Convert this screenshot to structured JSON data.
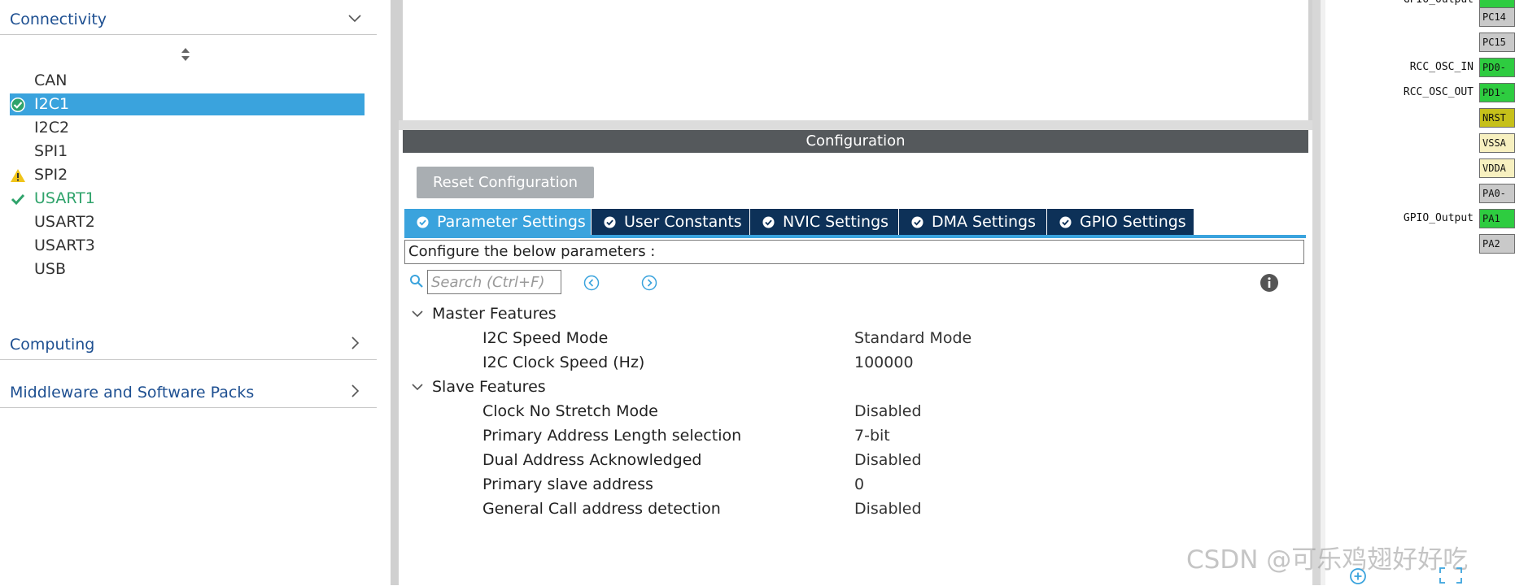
{
  "left_panel": {
    "categories": [
      {
        "label": "Connectivity",
        "expanded": true
      },
      {
        "label": "Computing",
        "expanded": false
      },
      {
        "label": "Middleware and Software Packs",
        "expanded": false
      }
    ],
    "peripherals": [
      {
        "label": "CAN",
        "status": "none"
      },
      {
        "label": "I2C1",
        "status": "ok",
        "selected": true
      },
      {
        "label": "I2C2",
        "status": "none"
      },
      {
        "label": "SPI1",
        "status": "none"
      },
      {
        "label": "SPI2",
        "status": "warning"
      },
      {
        "label": "USART1",
        "status": "ok"
      },
      {
        "label": "USART2",
        "status": "none"
      },
      {
        "label": "USART3",
        "status": "none"
      },
      {
        "label": "USB",
        "status": "none"
      }
    ]
  },
  "config": {
    "title": "Configuration",
    "reset_label": "Reset Configuration",
    "tabs": [
      {
        "label": "Parameter Settings",
        "active": true
      },
      {
        "label": "User Constants"
      },
      {
        "label": "NVIC Settings"
      },
      {
        "label": "DMA Settings"
      },
      {
        "label": "GPIO Settings"
      }
    ],
    "configure_text": "Configure the below parameters :",
    "search_placeholder": "Search (Ctrl+F)",
    "groups": [
      {
        "label": "Master Features",
        "params": [
          {
            "name": "I2C Speed Mode",
            "value": "Standard Mode"
          },
          {
            "name": "I2C Clock Speed (Hz)",
            "value": "100000"
          }
        ]
      },
      {
        "label": "Slave Features",
        "params": [
          {
            "name": "Clock No Stretch Mode",
            "value": "Disabled"
          },
          {
            "name": "Primary Address Length selection",
            "value": "7-bit"
          },
          {
            "name": "Dual Address Acknowledged",
            "value": "Disabled"
          },
          {
            "name": "Primary slave address",
            "value": "0"
          },
          {
            "name": "General Call address detection",
            "value": "Disabled"
          }
        ]
      }
    ]
  },
  "pinout": {
    "top_label": "GPIO_Output",
    "pins": [
      {
        "name": "PC14",
        "label": "",
        "color": "#c9c9c9"
      },
      {
        "name": "PC15",
        "label": "",
        "color": "#c9c9c9"
      },
      {
        "name": "PD0-",
        "label": "RCC_OSC_IN",
        "color": "#2ecc40"
      },
      {
        "name": "PD1-",
        "label": "RCC_OSC_OUT",
        "color": "#2ecc40"
      },
      {
        "name": "NRST",
        "label": "",
        "color": "#c6c01a"
      },
      {
        "name": "VSSA",
        "label": "",
        "color": "#f7f0c0"
      },
      {
        "name": "VDDA",
        "label": "",
        "color": "#f7f0c0"
      },
      {
        "name": "PA0-",
        "label": "",
        "color": "#c9c9c9"
      },
      {
        "name": "PA1",
        "label": "GPIO_Output",
        "color": "#2ecc40"
      },
      {
        "name": "PA2",
        "label": "",
        "color": "#c9c9c9"
      }
    ]
  },
  "watermark": "CSDN @可乐鸡翅好好吃",
  "colors": {
    "accent": "#3aa3dd",
    "tab_dark": "#0d3158",
    "category_text": "#1d4f91",
    "ok_green": "#2fa36b",
    "warning": "#f0c419"
  }
}
